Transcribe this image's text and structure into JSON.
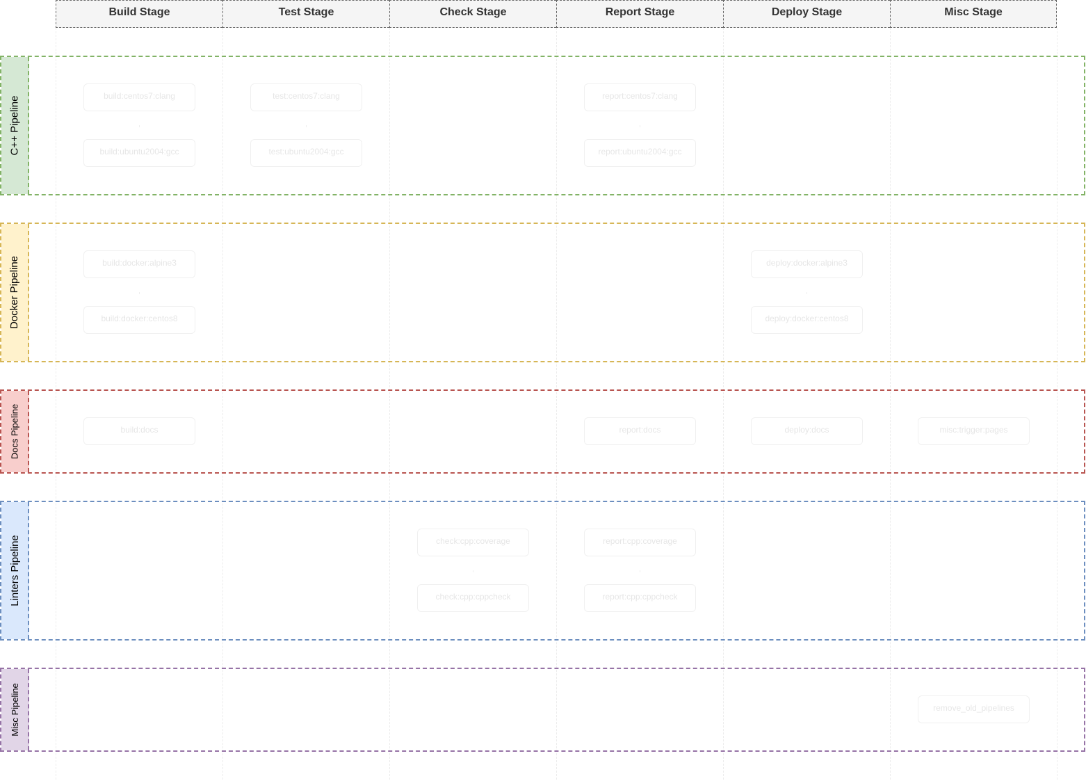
{
  "stages": [
    "Build Stage",
    "Test Stage",
    "Check Stage",
    "Report Stage",
    "Deploy Stage",
    "Misc Stage"
  ],
  "lanes": [
    {
      "label": "C++ Pipeline",
      "border": "#82b366",
      "fill": "#d5e8d4"
    },
    {
      "label": "Docker Pipeline",
      "border": "#d6b656",
      "fill": "#fff2cc"
    },
    {
      "label": "Docs Pipeline",
      "border": "#b85450",
      "fill": "#f8cecc"
    },
    {
      "label": "Linters Pipeline",
      "border": "#6c8ebf",
      "fill": "#dae8fc"
    },
    {
      "label": "Misc Pipeline",
      "border": "#9673a6",
      "fill": "#e1d5e7"
    }
  ],
  "jobs": [
    "build:centos7:clang",
    "build:ubuntu2004:gcc",
    "test:centos7:clang",
    "test:ubuntu2004:gcc",
    "report:centos7:clang",
    "report:ubuntu2004:gcc",
    "build:docker:alpine3",
    "build:docker:centos8",
    "deploy:docker:alpine3",
    "deploy:docker:centos8",
    "build:docs",
    "report:docs",
    "deploy:docs",
    "misc:trigger:pages",
    "check:cpp:coverage",
    "check:cpp:cppcheck",
    "report:cpp:coverage",
    "report:cpp:cppcheck",
    "remove_old_pipelines"
  ]
}
